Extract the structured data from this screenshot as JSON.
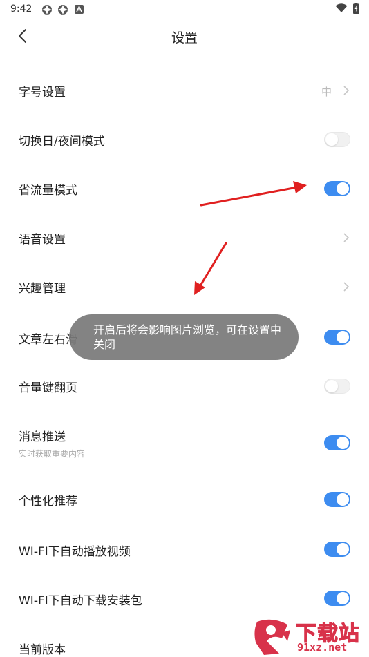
{
  "status_bar": {
    "time": "9:42",
    "icons": [
      "notification-icon",
      "notification-icon",
      "a-icon",
      "wifi-icon",
      "battery-icon"
    ]
  },
  "nav": {
    "title": "设置"
  },
  "settings": [
    {
      "label": "字号设置",
      "type": "value",
      "value": "中"
    },
    {
      "label": "切换日/夜间模式",
      "type": "toggle",
      "on": false
    },
    {
      "label": "省流量模式",
      "type": "toggle",
      "on": true
    },
    {
      "label": "语音设置",
      "type": "link"
    },
    {
      "label": "兴趣管理",
      "type": "link"
    },
    {
      "label": "文章左右滑",
      "type": "toggle",
      "on": true
    },
    {
      "label": "音量键翻页",
      "type": "toggle",
      "on": false
    },
    {
      "label": "消息推送",
      "sub": "实时获取重要内容",
      "type": "toggle",
      "on": true
    },
    {
      "label": "个性化推荐",
      "type": "toggle",
      "on": true
    },
    {
      "label": "WI-FI下自动播放视频",
      "type": "toggle",
      "on": true
    },
    {
      "label": "WI-FI下自动下载安装包",
      "type": "toggle",
      "on": true
    },
    {
      "label": "当前版本",
      "type": "static"
    }
  ],
  "toast": {
    "text": "开启后将会影响图片浏览，可在设置中关闭"
  },
  "watermark": {
    "title": "下载站",
    "site": "91xz.net"
  },
  "colors": {
    "toggle_on": "#3d8cf0",
    "toggle_off": "#f1f1f1",
    "arrow": "#e02020",
    "watermark": "#d8324a"
  }
}
